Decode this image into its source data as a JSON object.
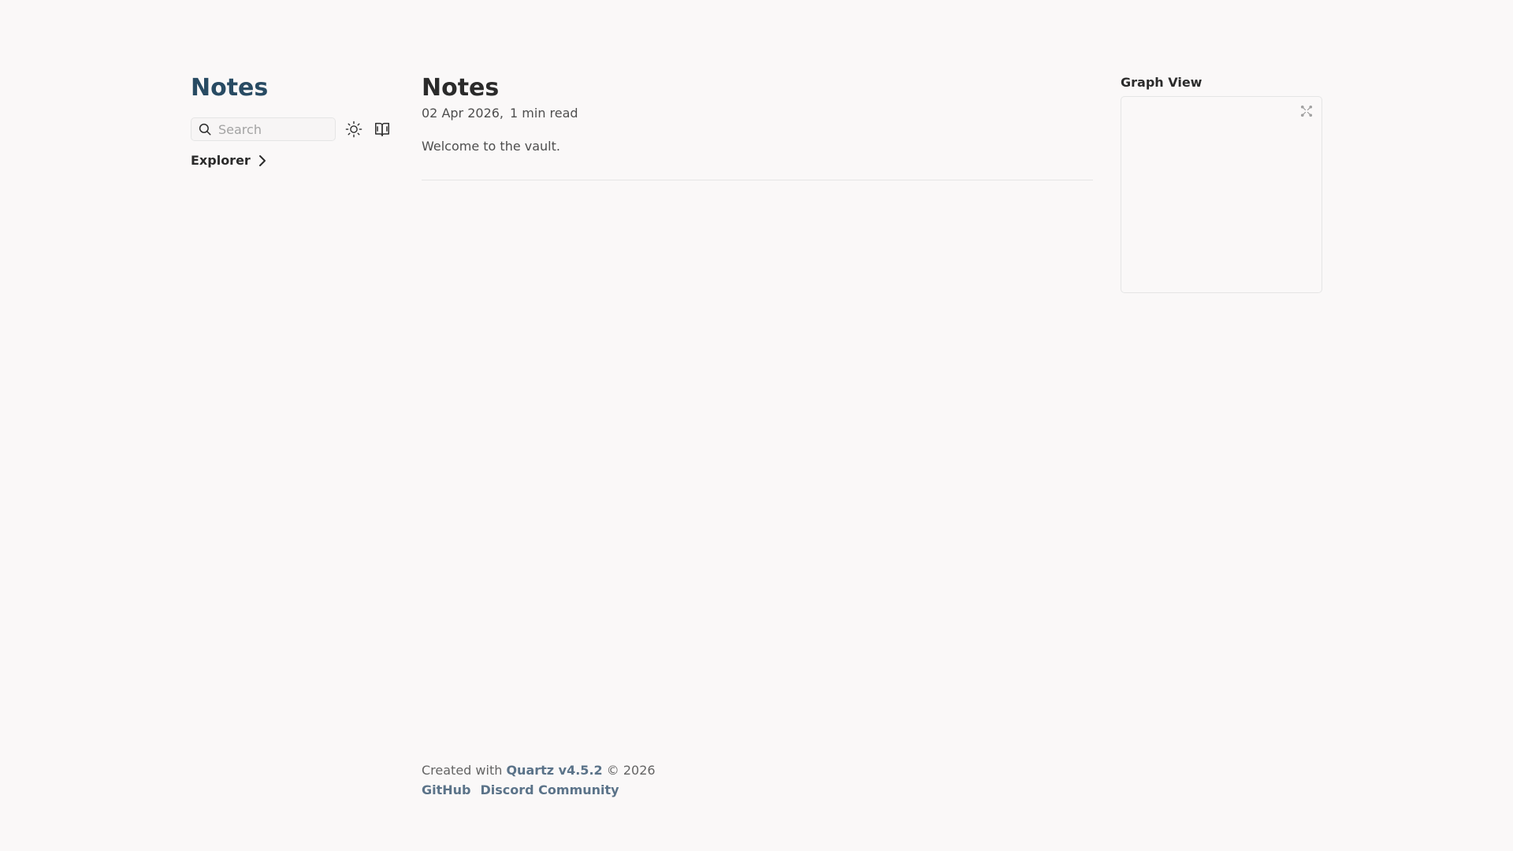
{
  "sidebar": {
    "site_title": "Notes",
    "search": {
      "placeholder": "Search"
    },
    "explorer_label": "Explorer",
    "icons": {
      "search": "search-icon",
      "theme_toggle": "sun-icon",
      "reader_mode": "book-icon",
      "explorer_toggle": "chevron-right-icon"
    }
  },
  "article": {
    "title": "Notes",
    "date": "02 Apr 2026,",
    "reading_time": "1 min read",
    "body": "Welcome to the vault."
  },
  "graph": {
    "title": "Graph View",
    "expand_icon": "expand-graph-icon"
  },
  "footer": {
    "created_prefix": "Created with",
    "quartz_link": "Quartz v4.5.2",
    "copyright": "© 2026",
    "links": [
      "GitHub",
      "Discord Community"
    ]
  },
  "colors": {
    "background": "#faf8f8",
    "title_accent": "#284b63",
    "link": "#5b7389",
    "text": "#2b2b2b",
    "muted": "#4e4e4e",
    "border": "#e5e5e5"
  }
}
